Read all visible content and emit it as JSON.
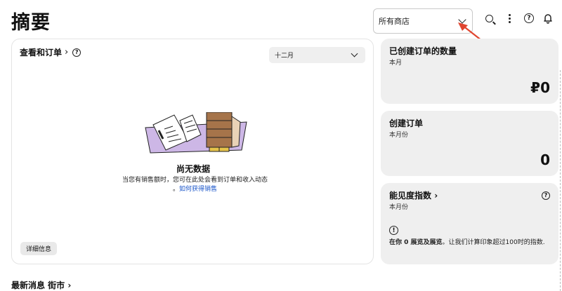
{
  "page": {
    "title": "摘要"
  },
  "header": {
    "store_selector": {
      "selected": "所有商店"
    },
    "icons": [
      "search-icon",
      "more-icon",
      "help-icon",
      "bell-icon"
    ]
  },
  "orders_card": {
    "title": "查看和订单",
    "title_caret": "›",
    "month_selector": {
      "selected": "十二月"
    },
    "empty_state": {
      "title": "尚无数据",
      "description": "当您有销售额时，您可在此处会看到订单和收入动态",
      "link_prefix": "。",
      "link_text": "如何获得销售"
    },
    "details_button": "详细信息"
  },
  "side_cards": {
    "created_orders_amount": {
      "title": "已创建订单的数量",
      "subtitle": "本月",
      "value": "₽0"
    },
    "created_orders": {
      "title": "创建订单",
      "subtitle": "本月份",
      "value": "0"
    },
    "visibility_index": {
      "title": "能见度指数",
      "title_caret": "›",
      "subtitle": "本月份",
      "info_icon": "!",
      "info_bold": "在你 0 展览及展览",
      "info_rest": "。让我们计算印象超过100时的指数."
    }
  },
  "news": {
    "title": "最新消息 街市",
    "caret": "›"
  },
  "colors": {
    "accent_link": "#1a55c9",
    "annotation_arrow": "#e0452f",
    "card_bg": "#efefef"
  }
}
